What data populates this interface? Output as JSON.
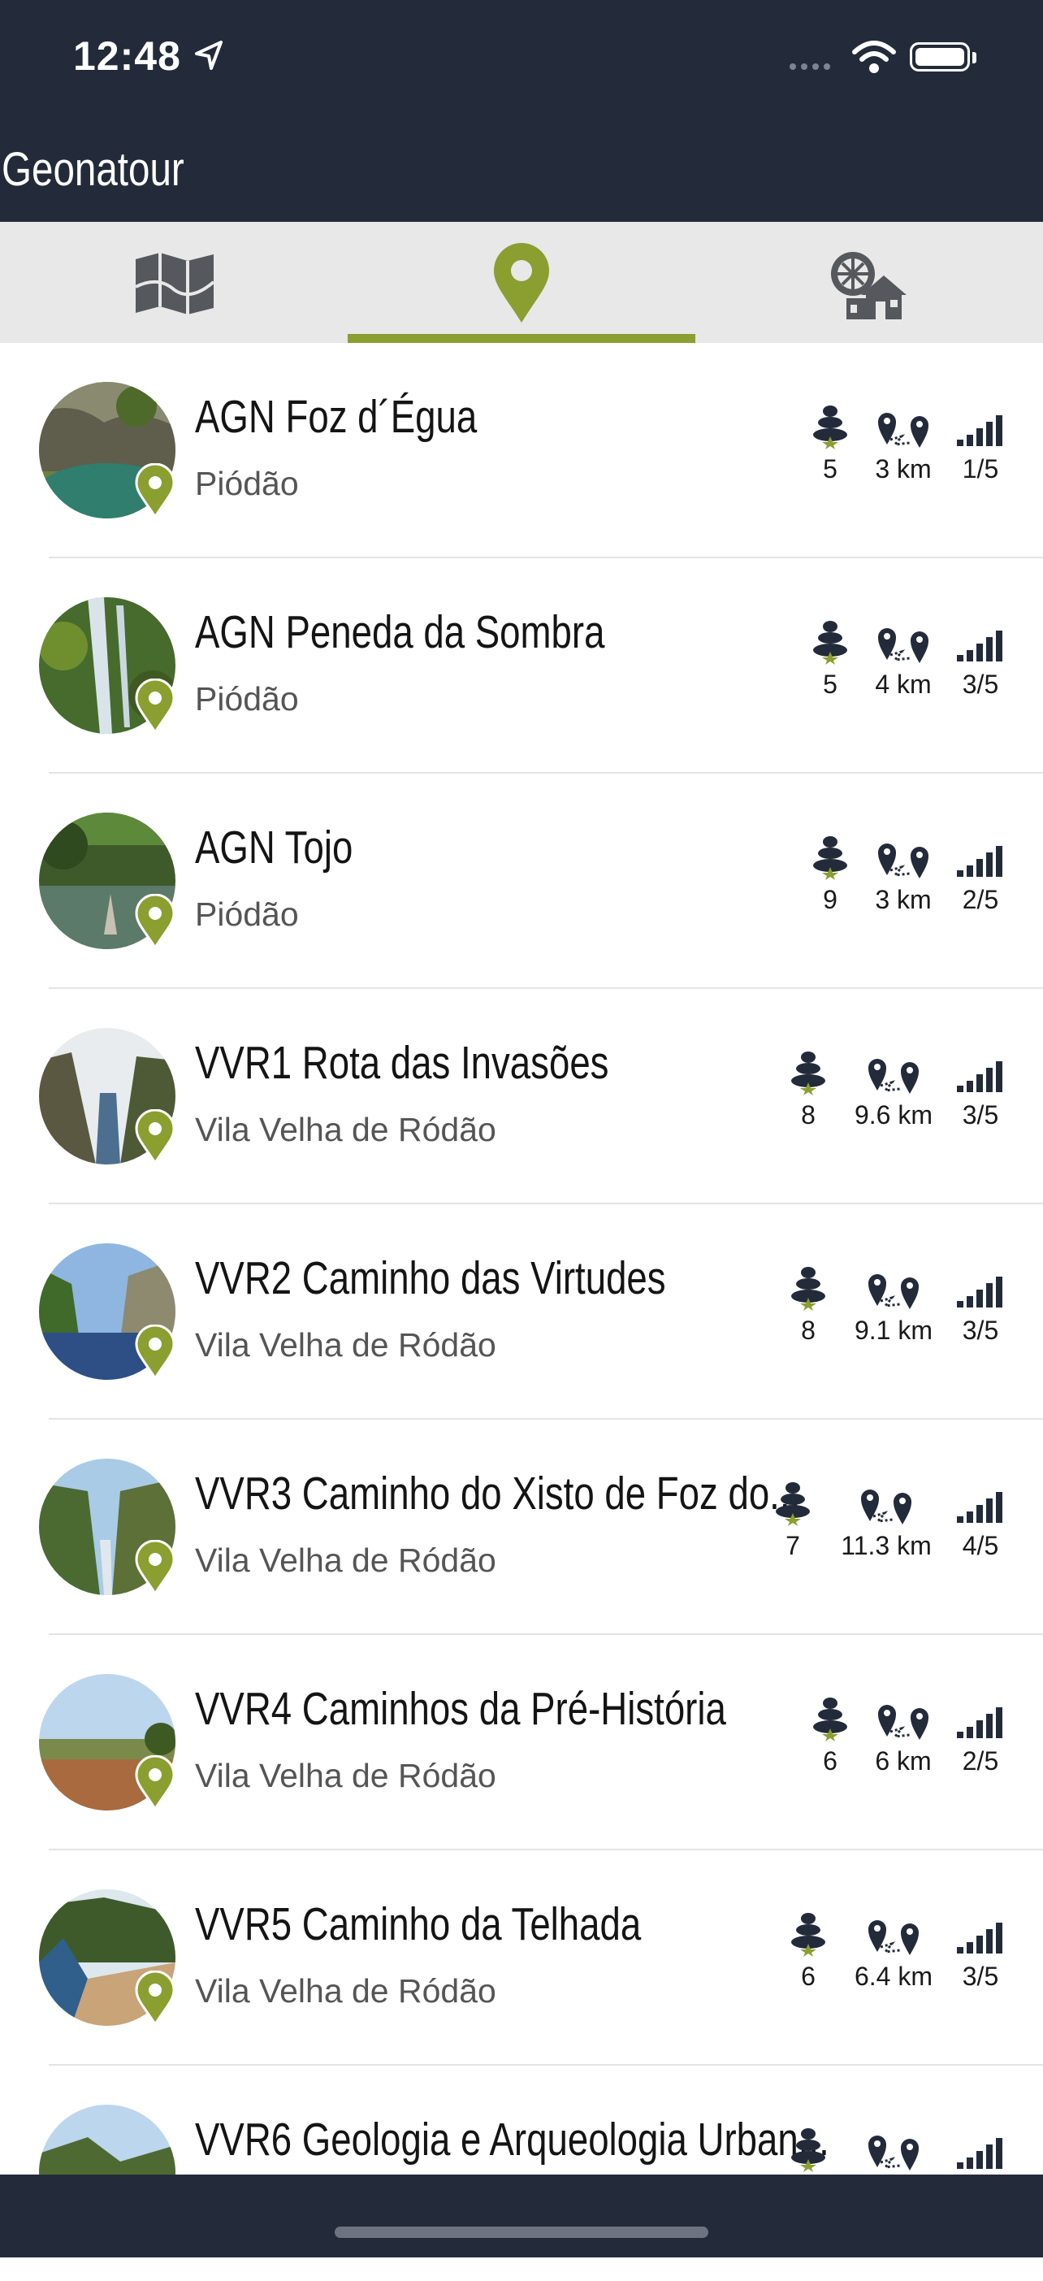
{
  "status_bar": {
    "time": "12:48"
  },
  "app": {
    "title": "Geonatour"
  },
  "tabs": [
    {
      "name": "map",
      "icon": "map-icon"
    },
    {
      "name": "locations",
      "icon": "location-pin-icon",
      "active": true
    },
    {
      "name": "heritage",
      "icon": "heritage-icon"
    }
  ],
  "colors": {
    "header": "#232b3a",
    "accent": "#8b9e30",
    "tabbar": "#e8e8e8"
  },
  "routes": [
    {
      "title": "AGN Foz d´Égua",
      "location": "Piódão",
      "points": "5",
      "distance": "3 km",
      "difficulty": "1/5"
    },
    {
      "title": "AGN Peneda da Sombra",
      "location": "Piódão",
      "points": "5",
      "distance": "4 km",
      "difficulty": "3/5"
    },
    {
      "title": "AGN Tojo",
      "location": "Piódão",
      "points": "9",
      "distance": "3 km",
      "difficulty": "2/5"
    },
    {
      "title": "VVR1 Rota das Invasões",
      "location": "Vila Velha de Ródão",
      "points": "8",
      "distance": "9.6 km",
      "difficulty": "3/5"
    },
    {
      "title": "VVR2 Caminho das Virtudes",
      "location": "Vila Velha de Ródão",
      "points": "8",
      "distance": "9.1 km",
      "difficulty": "3/5"
    },
    {
      "title": "VVR3 Caminho do Xisto de Foz do...",
      "location": "Vila Velha de Ródão",
      "points": "7",
      "distance": "11.3 km",
      "difficulty": "4/5"
    },
    {
      "title": "VVR4 Caminhos da Pré-História",
      "location": "Vila Velha de Ródão",
      "points": "6",
      "distance": "6 km",
      "difficulty": "2/5"
    },
    {
      "title": "VVR5 Caminho da Telhada",
      "location": "Vila Velha de Ródão",
      "points": "6",
      "distance": "6.4 km",
      "difficulty": "3/5"
    },
    {
      "title": "VVR6 Geologia e Arqueologia Urban...",
      "location": "",
      "points": "",
      "distance": "",
      "difficulty": ""
    }
  ]
}
